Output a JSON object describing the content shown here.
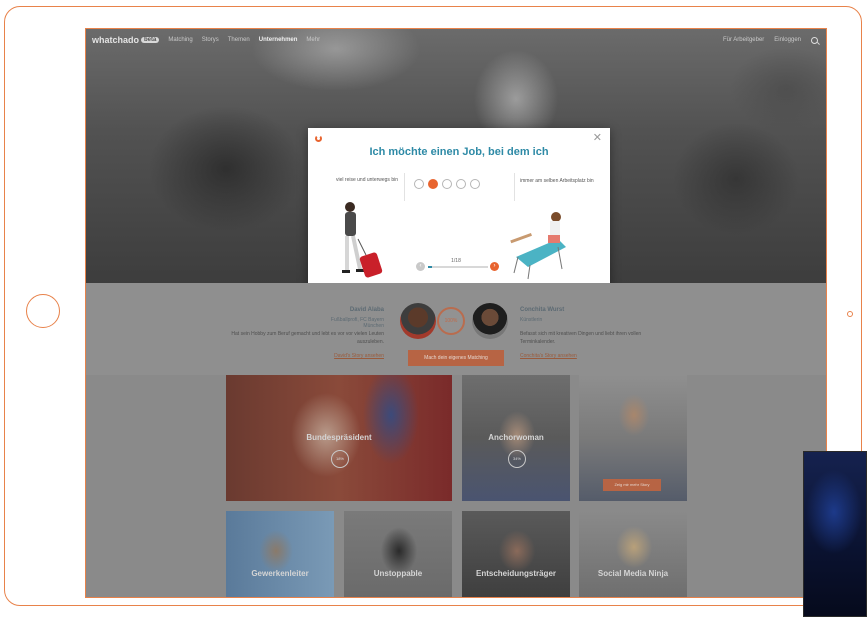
{
  "nav": {
    "logo": "whatchado",
    "logo_badge": "beta",
    "items": [
      "Matching",
      "Storys",
      "Themen",
      "Unternehmen",
      "Mehr"
    ],
    "active_index": 3,
    "right_links": [
      "Für Arbeitgeber",
      "Einloggen"
    ]
  },
  "modal": {
    "title": "Ich möchte einen Job, bei dem ich",
    "close_symbol": "✕",
    "left_statement": "viel reise und unterwegs bin",
    "right_statement": "immer am selben Arbeitsplatz bin",
    "choices_count": 5,
    "selected_choice": 2,
    "progress_label": "1/18",
    "progress_fraction": 0.06,
    "prev_symbol": "‹",
    "next_symbol": "›"
  },
  "profiles": {
    "left": {
      "name": "David Alaba",
      "role": "Fußballprofi, FC Bayern München",
      "desc": "Hat sein Hobby zum Beruf gemacht und lebt es vor vor vielen Leuten auszuleben.",
      "link": "David's Story ansehen"
    },
    "match_percent": "100%",
    "cta": "Mach dein eigenes Matching",
    "right": {
      "name": "Conchita Wurst",
      "role": "Künstlerin",
      "desc": "Befasst sich mit kreativen Dingen und liebt ihren vollen Terminkalender.",
      "link": "Conchita's Story ansehen"
    }
  },
  "tiles": [
    {
      "label": "Bundespräsident",
      "pct": "18%"
    },
    {
      "label": "Anchorwoman",
      "pct": "34%"
    },
    {
      "label": "",
      "pct": "",
      "button": "Zeig mir mehr Story"
    },
    {
      "label": "Gewerkenleiter",
      "pct": ""
    },
    {
      "label": "Unstoppable",
      "pct": ""
    },
    {
      "label": "Entscheidungsträger",
      "pct": ""
    },
    {
      "label": "Social Media Ninja",
      "pct": ""
    }
  ],
  "colors": {
    "accent_orange": "#e8642f",
    "title_teal": "#2e8aa6",
    "frame_orange": "#e8824a"
  }
}
